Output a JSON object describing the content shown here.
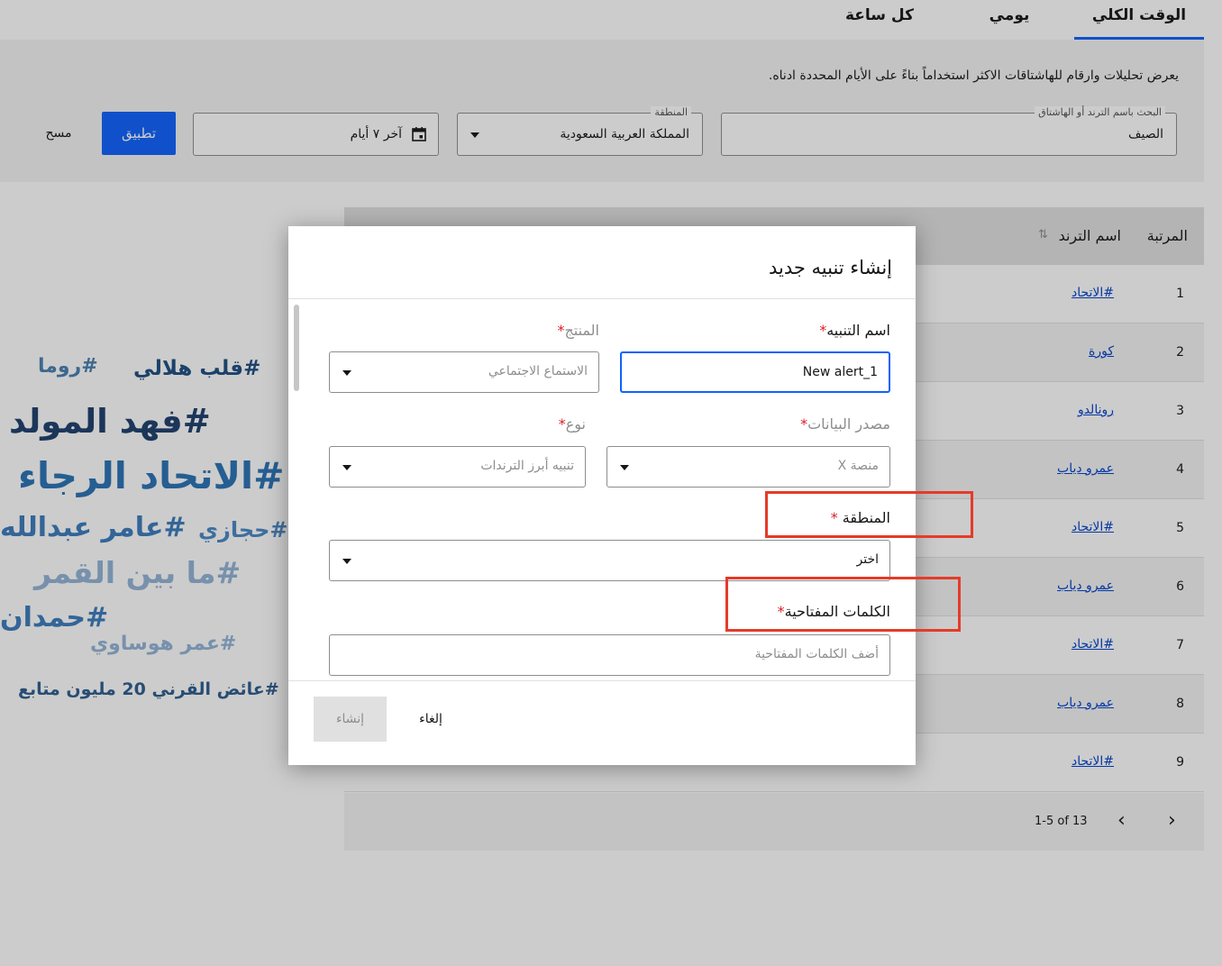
{
  "tabs": [
    {
      "label": "الوقت الكلي",
      "active": true
    },
    {
      "label": "يومي",
      "active": false
    },
    {
      "label": "كل ساعة",
      "active": false
    }
  ],
  "filters": {
    "description": "يعرض تحليلات وارقام للهاشتاقات الاكثر استخداماً بناءً على الأيام المحددة ادناه.",
    "search_label": "البحث باسم الترند أو الهاشتاق",
    "search_value": "الصيف",
    "region_label": "المنطقة",
    "region_value": "المملكة العربية السعودية",
    "date_value": "آخر ٧ أيام",
    "apply_label": "تطبيق",
    "clear_label": "مسح"
  },
  "table": {
    "headers": {
      "rank": "المرتبة",
      "trend": "اسم الترند"
    },
    "rows": [
      {
        "rank": "1",
        "trend": "#الاتحاد"
      },
      {
        "rank": "2",
        "trend": "كورة"
      },
      {
        "rank": "3",
        "trend": "رونالدو"
      },
      {
        "rank": "4",
        "trend": "عمرو دياب"
      },
      {
        "rank": "5",
        "trend": "#الاتحاد"
      },
      {
        "rank": "6",
        "trend": "عمرو دياب"
      },
      {
        "rank": "7",
        "trend": "#الاتحاد"
      },
      {
        "rank": "8",
        "trend": "عمرو دياب"
      },
      {
        "rank": "9",
        "trend": "#الاتحاد"
      }
    ],
    "pagination": {
      "text": "1-5 of 13",
      "prev": "‹",
      "next": "›"
    }
  },
  "word_cloud": [
    "#روما",
    "#قلب هلالي",
    "#فهد المولد",
    "#الاتحاد الرجاء",
    "#عامر عبدالله",
    "#حجازي",
    "#ما بين القمر",
    "#حمدان",
    "#عمر هوساوي",
    "#عائض القرني 20 مليون متابع"
  ],
  "modal": {
    "title": "إنشاء تنبيه جديد",
    "alert_name_label": "اسم التنبيه",
    "alert_name_value": "New alert_1",
    "product_label": "المنتج",
    "product_value": "الاستماع الاجتماعي",
    "data_source_label": "مصدر البيانات",
    "data_source_value": "منصة X",
    "type_label": "نوع",
    "type_value": "تنبيه أبرز الترندات",
    "region_label": "المنطقة",
    "region_placeholder": "اختر",
    "keywords_label": "الكلمات المفتاحية",
    "keywords_placeholder": "أضف الكلمات المفتاحية",
    "required_mark": "*",
    "create_label": "إنشاء",
    "cancel_label": "إلغاء"
  },
  "colors": {
    "primary": "#0f62fe",
    "highlight": "#e53b28",
    "required": "#da1e28"
  }
}
